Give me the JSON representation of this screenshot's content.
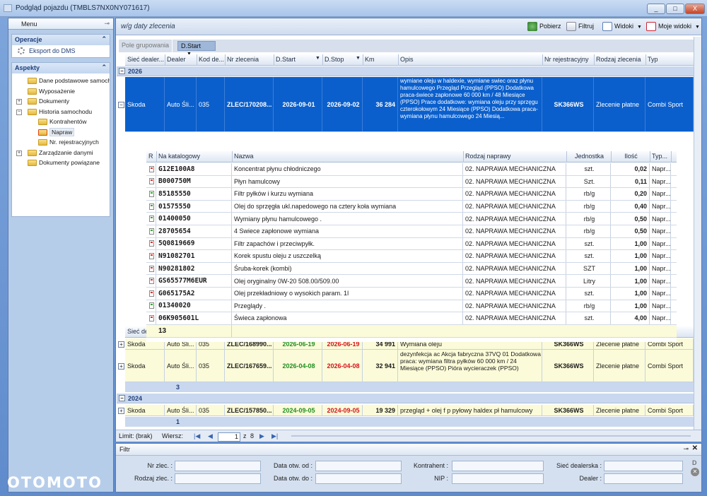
{
  "window": {
    "title": "Podgląd pojazdu (TMBLS7NX0NY071617)",
    "min": "_",
    "max": "□",
    "close": "X"
  },
  "menu": {
    "title": "Menu",
    "sections": {
      "operacje": {
        "title": "Operacje",
        "items": [
          "Eksport do DMS"
        ]
      },
      "aspekty": {
        "title": "Aspekty"
      }
    },
    "tree": [
      {
        "label": "Dane podstawowe samochodu",
        "level": 1,
        "pm": ""
      },
      {
        "label": "Wyposażenie",
        "level": 1,
        "pm": ""
      },
      {
        "label": "Dokumenty",
        "level": 1,
        "pm": "+"
      },
      {
        "label": "Historia samochodu",
        "level": 1,
        "pm": "−"
      },
      {
        "label": "Kontrahentów",
        "level": 2,
        "pm": ""
      },
      {
        "label": "Napraw",
        "level": 2,
        "pm": "",
        "selected": true
      },
      {
        "label": "Nr. rejestracyjnych",
        "level": 2,
        "pm": ""
      },
      {
        "label": "Zarządzanie danymi",
        "level": 1,
        "pm": "+"
      },
      {
        "label": "Dokumenty powiązane",
        "level": 1,
        "pm": ""
      }
    ]
  },
  "main": {
    "caption": "w/g daty zlecenia",
    "toolbar": {
      "pobierz": "Pobierz",
      "filtruj": "Filtruj",
      "widoki": "Widoki",
      "moje_widoki": "Moje widoki"
    },
    "group_panel": {
      "label": "Pole grupowania",
      "chip": "D.Start"
    },
    "columns": [
      "Sieć dealer...",
      "Dealer",
      "Kod de...",
      "Nr zlecenia",
      "D.Start",
      "D.Stop",
      "Km",
      "Opis",
      "Nr rejestracyjny",
      "Rodzaj zlecenia",
      "Typ"
    ],
    "columns2": [
      "Sieć deale...",
      "Dealer",
      "Kod de...",
      "Nr zlecenia",
      "D.Start",
      "D.Stop",
      "Km",
      "Opis",
      "Nr rejestracyjny",
      "Rodzaj zlecenia",
      "Typ"
    ],
    "groups": [
      {
        "year": "2026",
        "count": "3"
      },
      {
        "year": "2024",
        "count": "1"
      }
    ],
    "orders": [
      {
        "siec": "Skoda",
        "dealer": "Auto Śli...",
        "kod": "035",
        "nr": "ZLEC/170208...",
        "start": "2026-09-01",
        "stop": "2026-09-02",
        "km": "36 284",
        "opis": "wymiane oleju w haldexie, wymiane swiec oraz płynu hamulcowego   Przegląd  Przegląd (PPSO) Dodatkowa praca-świece zapłonowe 60 000 km / 48 Miesiące (PPSO) Prace dodatkowe: wymiana oleju przy sprzęgu czterokołowym  24 Miesiące (PPSO) Dodatkowa praca-wymiana płynu hamulcowego  24 Miesią...",
        "rej": "SK366WS",
        "rodzaj": "Zlecenie płatne",
        "typ": "Combi Sport"
      },
      {
        "siec": "Skoda",
        "dealer": "Auto Śli...",
        "kod": "035",
        "nr": "ZLEC/168990...",
        "start": "2026-06-19",
        "stop": "2026-06-19",
        "km": "34 991",
        "opis": "Wymiana oleju",
        "rej": "SK366WS",
        "rodzaj": "Zlecenie płatne",
        "typ": "Combi Sport"
      },
      {
        "siec": "Skoda",
        "dealer": "Auto Śli...",
        "kod": "035",
        "nr": "ZLEC/167659...",
        "start": "2026-04-08",
        "stop": "2026-04-08",
        "km": "32 941",
        "opis": "dezynfekcja ac Akcja fabryczna 37VQ      01 Dodatkowa praca: wymiana filtra pyłków 60 000 km / 24 Miesiące (PPSO) Pióra wycieraczek (PPSO)",
        "rej": "SK366WS",
        "rodzaj": "Zlecenie płatne",
        "typ": "Combi Sport"
      },
      {
        "siec": "Skoda",
        "dealer": "Auto Śli...",
        "kod": "035",
        "nr": "ZLEC/157850...",
        "start": "2024-09-05",
        "stop": "2024-09-05",
        "km": "19 329",
        "opis": "przegląd + olej f p pyłowy haldex pł hamulcowy",
        "rej": "SK366WS",
        "rodzaj": "Zlecenie płatne",
        "typ": "Combi Sport"
      }
    ],
    "detail": {
      "columns": [
        "R",
        "Na katalogowy",
        "Nazwa",
        "Rodzaj naprawy",
        "Jednostka",
        "Ilość",
        "Typ..."
      ],
      "rows": [
        {
          "kat": "G12E100A8",
          "nazwa": "Koncentrat płynu chłodniczego",
          "rodzaj": "02. NAPRAWA MECHANICZNA",
          "jedn": "szt.",
          "ilosc": "0,02",
          "typ": "Napr...",
          "icon": "r"
        },
        {
          "kat": "B000750M",
          "nazwa": "Płyn hamulcowy",
          "rodzaj": "02. NAPRAWA MECHANICZNA",
          "jedn": "Szt.",
          "ilosc": "0,11",
          "typ": "Napr...",
          "icon": "r"
        },
        {
          "kat": "85185550",
          "nazwa": "Filtr pyłków i kurzu wymiana",
          "rodzaj": "02. NAPRAWA MECHANICZNA",
          "jedn": "rb/g",
          "ilosc": "0,20",
          "typ": "Napr...",
          "icon": "g"
        },
        {
          "kat": "01575550",
          "nazwa": "Olej do sprzęgła ukl.napedowego na cztery koła wymiana",
          "rodzaj": "02. NAPRAWA MECHANICZNA",
          "jedn": "rb/g",
          "ilosc": "0,40",
          "typ": "Napr...",
          "icon": "g"
        },
        {
          "kat": "01400050",
          "nazwa": "Wymiany płynu hamulcowego .",
          "rodzaj": "02. NAPRAWA MECHANICZNA",
          "jedn": "rb/g",
          "ilosc": "0,50",
          "typ": "Napr...",
          "icon": "g"
        },
        {
          "kat": "28705654",
          "nazwa": "4 Swiece zapłonowe wymiana",
          "rodzaj": "02. NAPRAWA MECHANICZNA",
          "jedn": "rb/g",
          "ilosc": "0,50",
          "typ": "Napr...",
          "icon": "g"
        },
        {
          "kat": "5Q0819669",
          "nazwa": "Filtr zapachów i przeciwpyłk.",
          "rodzaj": "02. NAPRAWA MECHANICZNA",
          "jedn": "szt.",
          "ilosc": "1,00",
          "typ": "Napr...",
          "icon": "r"
        },
        {
          "kat": "N91082701",
          "nazwa": "Korek spustu oleju z uszczelką",
          "rodzaj": "02. NAPRAWA MECHANICZNA",
          "jedn": "szt.",
          "ilosc": "1,00",
          "typ": "Napr...",
          "icon": "r"
        },
        {
          "kat": "N90281802",
          "nazwa": "Śruba-korek (kombi)",
          "rodzaj": "02. NAPRAWA MECHANICZNA",
          "jedn": "SZT",
          "ilosc": "1,00",
          "typ": "Napr...",
          "icon": "r"
        },
        {
          "kat": "GS65577M6EUR",
          "nazwa": "Olej oryginalny 0W-20 508.00/509.00",
          "rodzaj": "02. NAPRAWA MECHANICZNA",
          "jedn": "Litry",
          "ilosc": "1,00",
          "typ": "Napr...",
          "icon": "r"
        },
        {
          "kat": "G065175A2",
          "nazwa": "Olej przekładniowy o wysokich param. 1l",
          "rodzaj": "02. NAPRAWA MECHANICZNA",
          "jedn": "szt.",
          "ilosc": "1,00",
          "typ": "Napr...",
          "icon": "r"
        },
        {
          "kat": "01340020",
          "nazwa": "Przeglądy .",
          "rodzaj": "02. NAPRAWA MECHANICZNA",
          "jedn": "rb/g",
          "ilosc": "1,00",
          "typ": "Napr...",
          "icon": "g"
        },
        {
          "kat": "06K905601L",
          "nazwa": "Świeca zapłonowa",
          "rodzaj": "02. NAPRAWA MECHANICZNA",
          "jedn": "szt.",
          "ilosc": "4,00",
          "typ": "Napr...",
          "icon": "r"
        }
      ],
      "summary_count": "13"
    },
    "nav": {
      "limit": "Limit: (brak)",
      "wiersz": "Wiersz:",
      "page": "1",
      "of": "z",
      "total": "8"
    }
  },
  "filter": {
    "title": "Filtr",
    "fields": {
      "nr_zlec": "Nr zlec. :",
      "rodzaj_zlec": "Rodzaj zlec. :",
      "data_od": "Data otw. od :",
      "data_do": "Data otw. do :",
      "kontrahent": "Kontrahent :",
      "nip": "NIP :",
      "siec": "Sieć dealerska :",
      "dealer": "Dealer :"
    }
  },
  "logo": "OTOMOTO",
  "colors": {
    "selected_row": "#0a5fcc",
    "group_band": "#c9d8ee",
    "highlight_row": "#fbfbd9",
    "date_start": "#1f8f1f",
    "date_stop": "#d4141a"
  }
}
